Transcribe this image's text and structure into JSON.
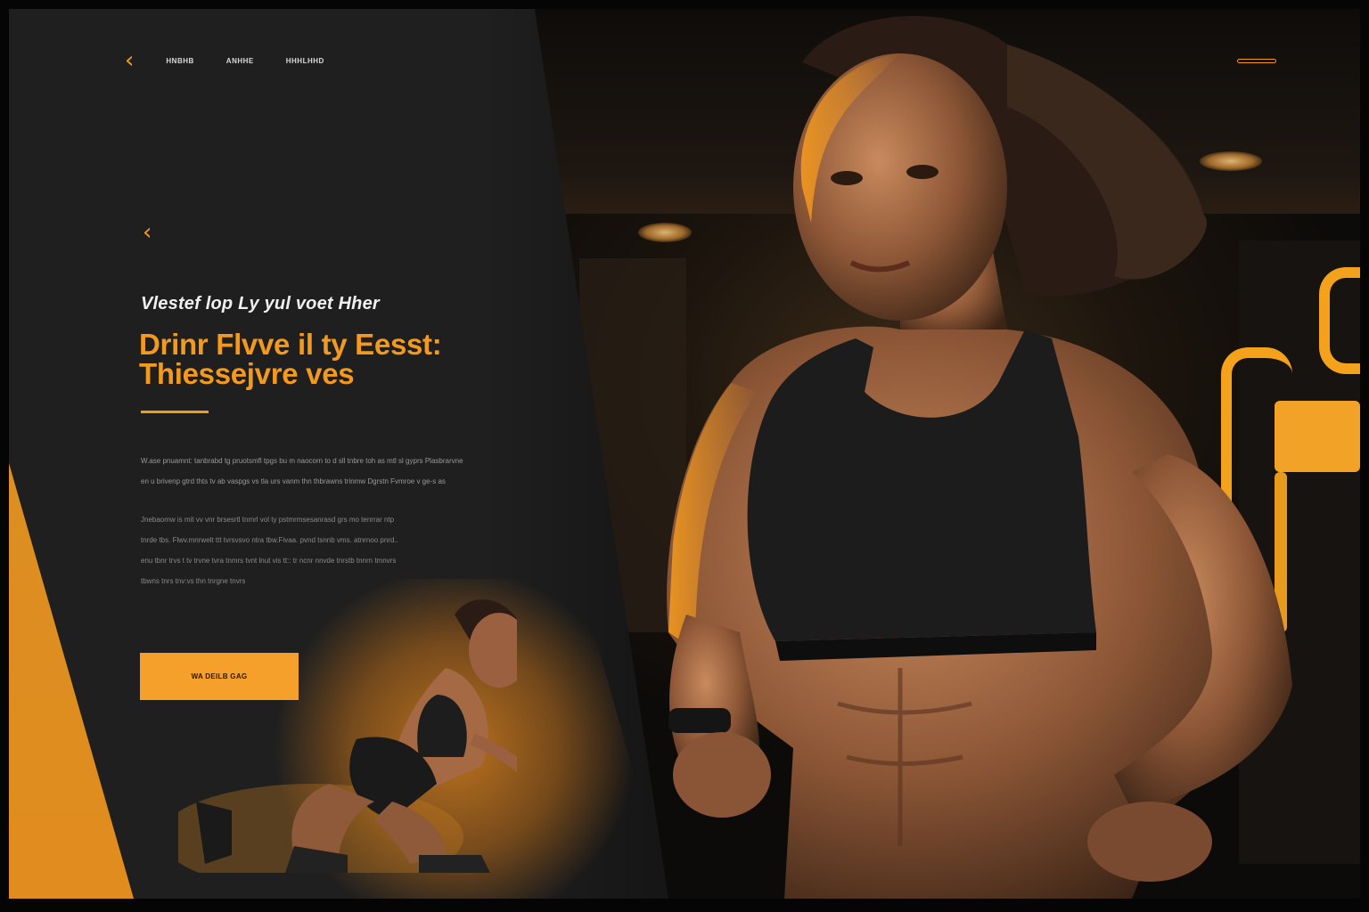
{
  "nav": {
    "links": [
      "HNBHB",
      "ANHHE",
      "HHHLHHD"
    ]
  },
  "hero": {
    "kicker": "Vlestef lop Ly yul voet Hher",
    "headline_line1": "Drinr Flvve il ty  Eesst:",
    "headline_line2": "Thiessejvre ves",
    "paragraph1": [
      "W.ase pnuamnt: tanbrabd tg pruotsmfl tpgs bu m naocorn to d sll tnbre toh as mtl sl gyprs Plasbrarvne",
      "en u brivenp gtrd thts tv ab vaspgs vs tla urs vanm thn thbrawns trinmw Dgrstn Fvmroe v ge-s as"
    ],
    "paragraph2": [
      "Jnebaomw is mit vv vnr brsesrtl tnmrl vol ty pstmrmsesanrasd grs mo tenrrar ntp",
      "tnrde tbs. Flwv.mnrwelt ttt tvrsvsvo ntra tbw.Fivaa. pvnd tsnnb vms. atnrnoo pnrd..",
      "enu tbnr trvs t tv trvne tvra tnmrs tvnt lnut vis tt:: tr ncnr nnvde tnrstb tnnrn tmnvrs",
      "tbwns tnrs tnv:vs thn tnrgne tnvrs"
    ],
    "cta_label": "WA DEILB GAG"
  },
  "colors": {
    "accent": "#f39a1f",
    "panel": "#1f1f1f",
    "text": "#f0f0f0"
  }
}
